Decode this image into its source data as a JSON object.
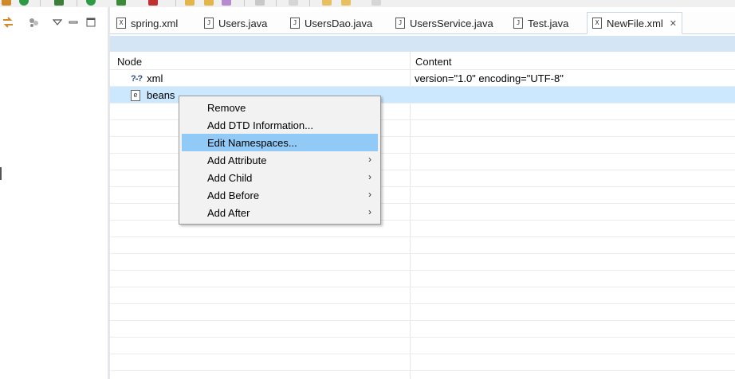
{
  "tabs": [
    {
      "label": "spring.xml",
      "icon": "xml-file-icon"
    },
    {
      "label": "Users.java",
      "icon": "java-file-icon"
    },
    {
      "label": "UsersDao.java",
      "icon": "java-file-icon"
    },
    {
      "label": "UsersService.java",
      "icon": "java-file-icon"
    },
    {
      "label": "Test.java",
      "icon": "java-file-icon"
    },
    {
      "label": "NewFile.xml",
      "icon": "xml-file-icon",
      "active": true
    }
  ],
  "table": {
    "headers": {
      "node": "Node",
      "content": "Content"
    },
    "rows": [
      {
        "node": "xml",
        "icon": "?-?",
        "content": "version=\"1.0\" encoding=\"UTF-8\""
      },
      {
        "node": "beans",
        "icon": "e",
        "content": ""
      }
    ]
  },
  "context_menu": {
    "items": [
      {
        "label": "Remove"
      },
      {
        "label": "Add DTD Information..."
      },
      {
        "label": "Edit Namespaces...",
        "highlighted": true
      },
      {
        "label": "Add Attribute",
        "submenu": true
      },
      {
        "label": "Add Child",
        "submenu": true
      },
      {
        "label": "Add Before",
        "submenu": true
      },
      {
        "label": "Add After",
        "submenu": true
      }
    ]
  },
  "colors": {
    "selection": "#cce8ff",
    "menu_highlight": "#91c9f7",
    "header_strip": "#d4e5f5"
  }
}
